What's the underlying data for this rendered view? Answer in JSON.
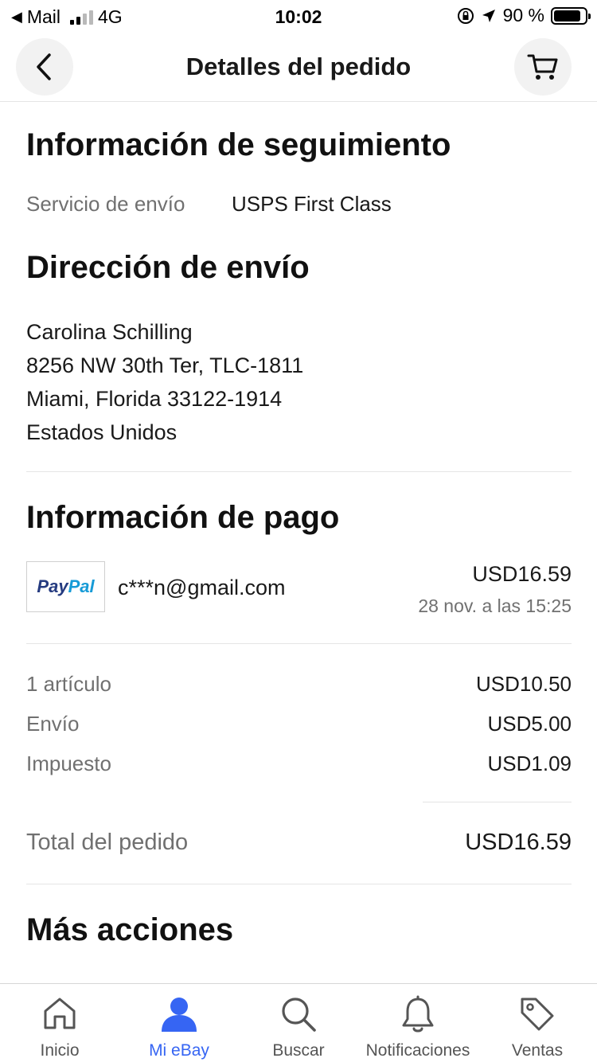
{
  "status_bar": {
    "back_app": "Mail",
    "network": "4G",
    "time": "10:02",
    "battery": "90 %"
  },
  "header": {
    "title": "Detalles del pedido",
    "back_icon": "chevron-left-icon",
    "cart_icon": "cart-icon"
  },
  "tracking": {
    "heading": "Información de seguimiento",
    "service_label": "Servicio de envío",
    "service_value": "USPS First Class"
  },
  "shipping": {
    "heading": "Dirección de envío",
    "lines": [
      "Carolina Schilling",
      "8256 NW 30th Ter, TLC-1811",
      "Miami, Florida 33122-1914",
      "Estados Unidos"
    ]
  },
  "payment": {
    "heading": "Información de pago",
    "method_logo_pay": "Pay",
    "method_logo_pal": "Pal",
    "email": "c***n@gmail.com",
    "amount": "USD16.59",
    "date": "28 nov. a las 15:25"
  },
  "summary": {
    "rows": [
      {
        "label": "1 artículo",
        "value": "USD10.50"
      },
      {
        "label": "Envío",
        "value": "USD5.00"
      },
      {
        "label": "Impuesto",
        "value": "USD1.09"
      }
    ],
    "total_label": "Total del pedido",
    "total_value": "USD16.59"
  },
  "more": {
    "heading": "Más acciones"
  },
  "tabbar": {
    "items": [
      {
        "label": "Inicio",
        "icon": "home-icon",
        "active": false
      },
      {
        "label": "Mi eBay",
        "icon": "user-icon",
        "active": true
      },
      {
        "label": "Buscar",
        "icon": "search-icon",
        "active": false
      },
      {
        "label": "Notificaciones",
        "icon": "bell-icon",
        "active": false
      },
      {
        "label": "Ventas",
        "icon": "tag-icon",
        "active": false
      }
    ]
  },
  "colors": {
    "accent": "#3665f3",
    "text": "#191919",
    "muted": "#707070",
    "divider": "#e5e5e5"
  }
}
